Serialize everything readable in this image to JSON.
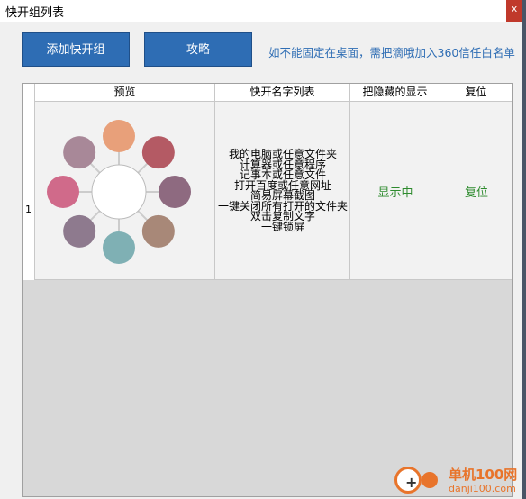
{
  "window": {
    "title": "快开组列表",
    "close": "x"
  },
  "toolbar": {
    "add_group_label": "添加快开组",
    "guide_label": "攻略",
    "notice": "如不能固定在桌面，需把滴哦加入360信任白名单"
  },
  "table": {
    "columns": [
      "预览",
      "快开名字列表",
      "把隐藏的显示",
      "复位"
    ],
    "rows": [
      {
        "index": "1",
        "names": [
          "我的电脑或任意文件夹",
          "计算器或任意程序",
          "记事本或任意文件",
          "打开百度或任意网址",
          "简易屏幕截图",
          "一键关闭所有打开的文件夹",
          "双击复制文字",
          "一键锁屏"
        ],
        "show_hidden": "显示中",
        "reset": "复位"
      }
    ]
  },
  "preview": {
    "petal_colors": [
      "#e8a07a",
      "#b45a64",
      "#8e6a80",
      "#a88878",
      "#7fb0b4",
      "#8e7a8e",
      "#d06a8a",
      "#a88898"
    ]
  },
  "watermark": {
    "title": "单机100网",
    "url": "danji100.com",
    "accent": "#e8742b"
  }
}
